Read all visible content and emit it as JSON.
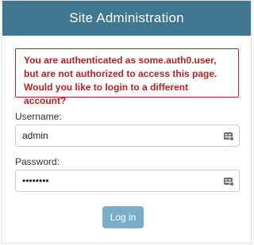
{
  "header": {
    "title": "Site Administration"
  },
  "error": {
    "message": "You are authenticated as some.auth0.user, but are not authorized to access this page. Would you like to login to a different account?"
  },
  "form": {
    "username": {
      "label": "Username:",
      "value": "admin"
    },
    "password": {
      "label": "Password:",
      "value": "••••••••"
    },
    "submit_label": "Log in"
  },
  "colors": {
    "header_bg": "#417690",
    "error": "#ba2121",
    "button_bg": "#79aec8"
  },
  "icons": {
    "field_icon": "password-manager-icon"
  }
}
